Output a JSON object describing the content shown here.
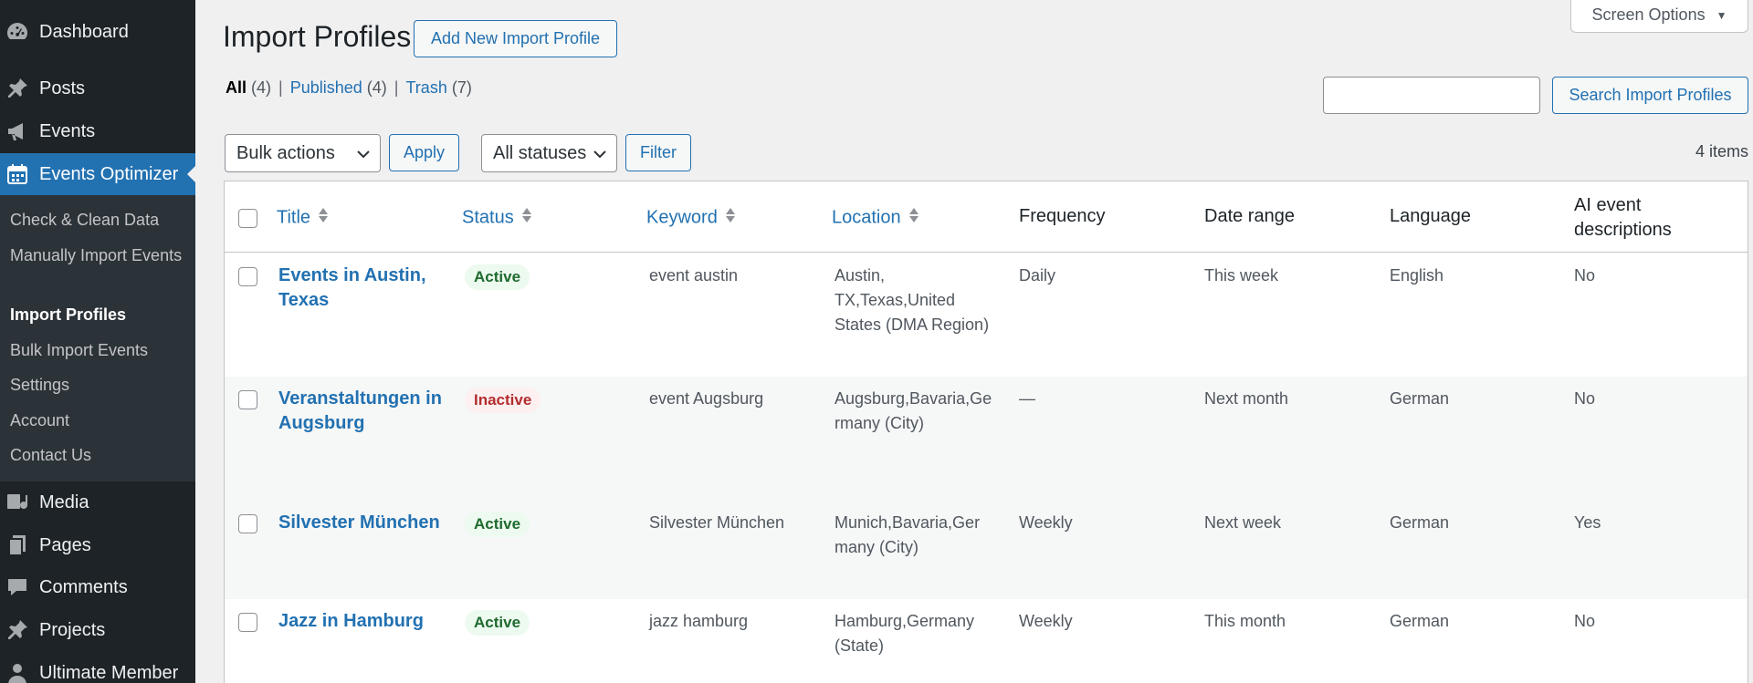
{
  "sidebar": {
    "menu": [
      {
        "label": "Dashboard",
        "icon": "dashboard-icon"
      },
      {
        "label": "Posts",
        "icon": "pin-icon"
      },
      {
        "label": "Events",
        "icon": "megaphone-icon"
      },
      {
        "label": "Events Optimizer",
        "icon": "calendar-icon"
      },
      {
        "label": "Media",
        "icon": "media-icon"
      },
      {
        "label": "Pages",
        "icon": "pages-icon"
      },
      {
        "label": "Comments",
        "icon": "comment-icon"
      },
      {
        "label": "Projects",
        "icon": "pin-icon"
      },
      {
        "label": "Ultimate Member",
        "icon": "user-icon"
      }
    ],
    "submenu": [
      {
        "label": "Check & Clean Data"
      },
      {
        "label": "Manually Import Events"
      },
      {
        "label": "Import Profiles"
      },
      {
        "label": "Bulk Import Events"
      },
      {
        "label": "Settings"
      },
      {
        "label": "Account"
      },
      {
        "label": "Contact Us"
      }
    ]
  },
  "header": {
    "title": "Import Profiles",
    "add_new_label": "Add New Import Profile",
    "screen_options_label": "Screen Options"
  },
  "views": {
    "all_label": "All",
    "all_count": "(4)",
    "published_label": "Published",
    "published_count": "(4)",
    "trash_label": "Trash",
    "trash_count": "(7)"
  },
  "search": {
    "value": "",
    "button_label": "Search Import Profiles"
  },
  "toolbar": {
    "bulk_actions_selected": "Bulk actions",
    "apply_label": "Apply",
    "status_selected": "All statuses",
    "filter_label": "Filter",
    "items_count": "4 items"
  },
  "table": {
    "columns": {
      "title": "Title",
      "status": "Status",
      "keyword": "Keyword",
      "location": "Location",
      "frequency": "Frequency",
      "date_range": "Date range",
      "language": "Language",
      "ai_line1": "AI event",
      "ai_line2": "descriptions"
    },
    "rows": [
      {
        "title_l1": "Events in Austin,",
        "title_l2": "Texas",
        "status": "Active",
        "keyword": "event austin",
        "loc_l1": "Austin,",
        "loc_l2": "TX,Texas,United",
        "loc_l3": "States (DMA Region)",
        "frequency": "Daily",
        "date_range": "This week",
        "language": "English",
        "ai": "No"
      },
      {
        "title_l1": "Veranstaltungen in",
        "title_l2": "Augsburg",
        "status": "Inactive",
        "keyword": "event Augsburg",
        "loc_l1": "Augsburg,Bavaria,Ge",
        "loc_l2": "rmany (City)",
        "loc_l3": "",
        "frequency": "—",
        "date_range": "Next month",
        "language": "German",
        "ai": "No"
      },
      {
        "title_l1": "Silvester München",
        "title_l2": "",
        "status": "Active",
        "keyword": "Silvester München",
        "loc_l1": "Munich,Bavaria,Ger",
        "loc_l2": "many (City)",
        "loc_l3": "",
        "frequency": "Weekly",
        "date_range": "Next week",
        "language": "German",
        "ai": "Yes"
      },
      {
        "title_l1": "Jazz in Hamburg",
        "title_l2": "",
        "status": "Active",
        "keyword": "jazz hamburg",
        "loc_l1": "Hamburg,Germany",
        "loc_l2": "(State)",
        "loc_l3": "",
        "frequency": "Weekly",
        "date_range": "This month",
        "language": "German",
        "ai": "No"
      }
    ]
  },
  "colors": {
    "sidebar_bg": "#1d2327",
    "accent": "#2271b1",
    "active_badge": "#1e6a2e",
    "inactive_badge": "#b32d2e"
  }
}
